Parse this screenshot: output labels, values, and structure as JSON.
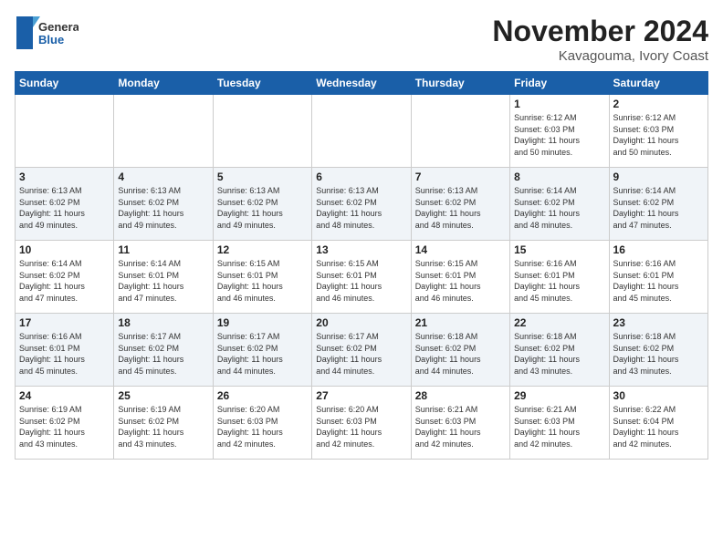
{
  "header": {
    "logo_line1": "General",
    "logo_line2": "Blue",
    "month": "November 2024",
    "location": "Kavagouma, Ivory Coast"
  },
  "weekdays": [
    "Sunday",
    "Monday",
    "Tuesday",
    "Wednesday",
    "Thursday",
    "Friday",
    "Saturday"
  ],
  "weeks": [
    [
      {
        "day": "",
        "text": ""
      },
      {
        "day": "",
        "text": ""
      },
      {
        "day": "",
        "text": ""
      },
      {
        "day": "",
        "text": ""
      },
      {
        "day": "",
        "text": ""
      },
      {
        "day": "1",
        "text": "Sunrise: 6:12 AM\nSunset: 6:03 PM\nDaylight: 11 hours\nand 50 minutes."
      },
      {
        "day": "2",
        "text": "Sunrise: 6:12 AM\nSunset: 6:03 PM\nDaylight: 11 hours\nand 50 minutes."
      }
    ],
    [
      {
        "day": "3",
        "text": "Sunrise: 6:13 AM\nSunset: 6:02 PM\nDaylight: 11 hours\nand 49 minutes."
      },
      {
        "day": "4",
        "text": "Sunrise: 6:13 AM\nSunset: 6:02 PM\nDaylight: 11 hours\nand 49 minutes."
      },
      {
        "day": "5",
        "text": "Sunrise: 6:13 AM\nSunset: 6:02 PM\nDaylight: 11 hours\nand 49 minutes."
      },
      {
        "day": "6",
        "text": "Sunrise: 6:13 AM\nSunset: 6:02 PM\nDaylight: 11 hours\nand 48 minutes."
      },
      {
        "day": "7",
        "text": "Sunrise: 6:13 AM\nSunset: 6:02 PM\nDaylight: 11 hours\nand 48 minutes."
      },
      {
        "day": "8",
        "text": "Sunrise: 6:14 AM\nSunset: 6:02 PM\nDaylight: 11 hours\nand 48 minutes."
      },
      {
        "day": "9",
        "text": "Sunrise: 6:14 AM\nSunset: 6:02 PM\nDaylight: 11 hours\nand 47 minutes."
      }
    ],
    [
      {
        "day": "10",
        "text": "Sunrise: 6:14 AM\nSunset: 6:02 PM\nDaylight: 11 hours\nand 47 minutes."
      },
      {
        "day": "11",
        "text": "Sunrise: 6:14 AM\nSunset: 6:01 PM\nDaylight: 11 hours\nand 47 minutes."
      },
      {
        "day": "12",
        "text": "Sunrise: 6:15 AM\nSunset: 6:01 PM\nDaylight: 11 hours\nand 46 minutes."
      },
      {
        "day": "13",
        "text": "Sunrise: 6:15 AM\nSunset: 6:01 PM\nDaylight: 11 hours\nand 46 minutes."
      },
      {
        "day": "14",
        "text": "Sunrise: 6:15 AM\nSunset: 6:01 PM\nDaylight: 11 hours\nand 46 minutes."
      },
      {
        "day": "15",
        "text": "Sunrise: 6:16 AM\nSunset: 6:01 PM\nDaylight: 11 hours\nand 45 minutes."
      },
      {
        "day": "16",
        "text": "Sunrise: 6:16 AM\nSunset: 6:01 PM\nDaylight: 11 hours\nand 45 minutes."
      }
    ],
    [
      {
        "day": "17",
        "text": "Sunrise: 6:16 AM\nSunset: 6:01 PM\nDaylight: 11 hours\nand 45 minutes."
      },
      {
        "day": "18",
        "text": "Sunrise: 6:17 AM\nSunset: 6:02 PM\nDaylight: 11 hours\nand 45 minutes."
      },
      {
        "day": "19",
        "text": "Sunrise: 6:17 AM\nSunset: 6:02 PM\nDaylight: 11 hours\nand 44 minutes."
      },
      {
        "day": "20",
        "text": "Sunrise: 6:17 AM\nSunset: 6:02 PM\nDaylight: 11 hours\nand 44 minutes."
      },
      {
        "day": "21",
        "text": "Sunrise: 6:18 AM\nSunset: 6:02 PM\nDaylight: 11 hours\nand 44 minutes."
      },
      {
        "day": "22",
        "text": "Sunrise: 6:18 AM\nSunset: 6:02 PM\nDaylight: 11 hours\nand 43 minutes."
      },
      {
        "day": "23",
        "text": "Sunrise: 6:18 AM\nSunset: 6:02 PM\nDaylight: 11 hours\nand 43 minutes."
      }
    ],
    [
      {
        "day": "24",
        "text": "Sunrise: 6:19 AM\nSunset: 6:02 PM\nDaylight: 11 hours\nand 43 minutes."
      },
      {
        "day": "25",
        "text": "Sunrise: 6:19 AM\nSunset: 6:02 PM\nDaylight: 11 hours\nand 43 minutes."
      },
      {
        "day": "26",
        "text": "Sunrise: 6:20 AM\nSunset: 6:03 PM\nDaylight: 11 hours\nand 42 minutes."
      },
      {
        "day": "27",
        "text": "Sunrise: 6:20 AM\nSunset: 6:03 PM\nDaylight: 11 hours\nand 42 minutes."
      },
      {
        "day": "28",
        "text": "Sunrise: 6:21 AM\nSunset: 6:03 PM\nDaylight: 11 hours\nand 42 minutes."
      },
      {
        "day": "29",
        "text": "Sunrise: 6:21 AM\nSunset: 6:03 PM\nDaylight: 11 hours\nand 42 minutes."
      },
      {
        "day": "30",
        "text": "Sunrise: 6:22 AM\nSunset: 6:04 PM\nDaylight: 11 hours\nand 42 minutes."
      }
    ]
  ]
}
